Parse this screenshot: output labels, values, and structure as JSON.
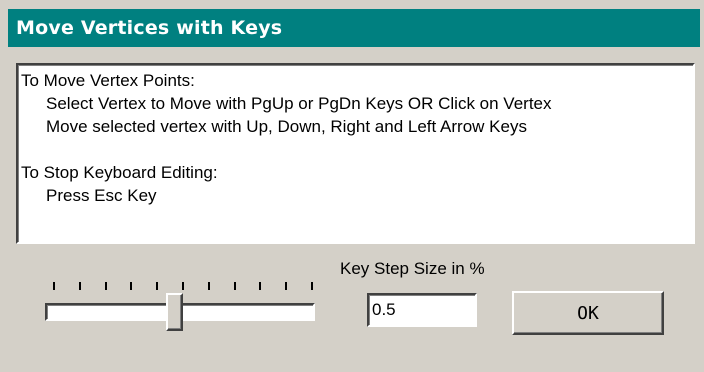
{
  "window": {
    "title": "Move Vertices with Keys",
    "title_bg": "#008080"
  },
  "instructions": {
    "heading_move": "To Move Vertex Points:",
    "move_line1": "Select Vertex to Move with PgUp or PgDn Keys OR Click on Vertex",
    "move_line2": "Move selected vertex with Up, Down, Right and Left Arrow Keys",
    "heading_stop": "To Stop Keyboard Editing:",
    "stop_line1": "Press Esc Key"
  },
  "slider": {
    "tick_count": 11,
    "position_fraction": 0.47
  },
  "step": {
    "label": "Key Step Size in %",
    "value": "0.5"
  },
  "buttons": {
    "ok_label": "OK"
  }
}
